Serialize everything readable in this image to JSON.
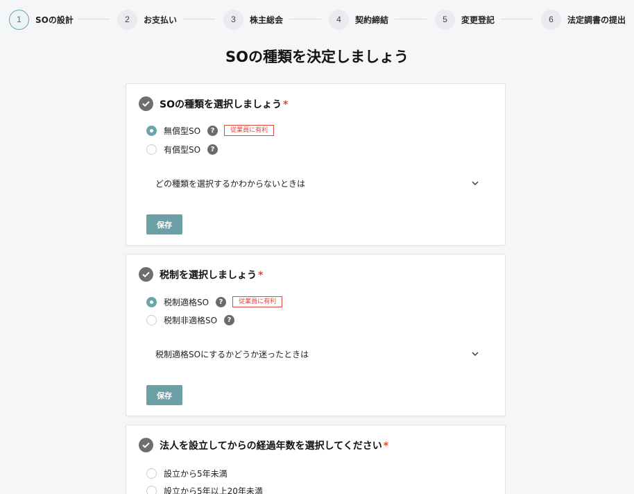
{
  "stepper": {
    "steps": [
      {
        "number": "1",
        "label": "SOの設計"
      },
      {
        "number": "2",
        "label": "お支払い"
      },
      {
        "number": "3",
        "label": "株主総会"
      },
      {
        "number": "4",
        "label": "契約締結"
      },
      {
        "number": "5",
        "label": "変更登記"
      },
      {
        "number": "6",
        "label": "法定調書の提出"
      }
    ],
    "active_step": "1"
  },
  "page_title": "SOの種類を決定しましょう",
  "colors": {
    "accent": "#6aa0a6",
    "required": "#e0453a",
    "badge": "#e0453a",
    "background": "#f5f6f8"
  },
  "cards": [
    {
      "title": "SOの種類を選択しましょう",
      "required_mark": "*",
      "options": [
        {
          "label": "無償型SO",
          "selected": true,
          "help": "?",
          "badge": "従業員に有利"
        },
        {
          "label": "有償型SO",
          "selected": false,
          "help": "?"
        }
      ],
      "accordion_label": "どの種類を選択するかわからないときは",
      "save_label": "保存"
    },
    {
      "title": "税制を選択しましょう",
      "required_mark": "*",
      "options": [
        {
          "label": "税制適格SO",
          "selected": true,
          "help": "?",
          "badge": "従業員に有利"
        },
        {
          "label": "税制非適格SO",
          "selected": false,
          "help": "?"
        }
      ],
      "accordion_label": "税制適格SOにするかどうか迷ったときは",
      "save_label": "保存"
    },
    {
      "title": "法人を設立してからの経過年数を選択してください",
      "required_mark": "*",
      "options": [
        {
          "label": "設立から5年未満",
          "selected": false
        },
        {
          "label": "設立から5年以上20年未満",
          "selected": false
        }
      ]
    }
  ],
  "icons": {
    "step_check": "check-icon",
    "accordion": "chevron-down-icon",
    "help": "question-icon"
  }
}
